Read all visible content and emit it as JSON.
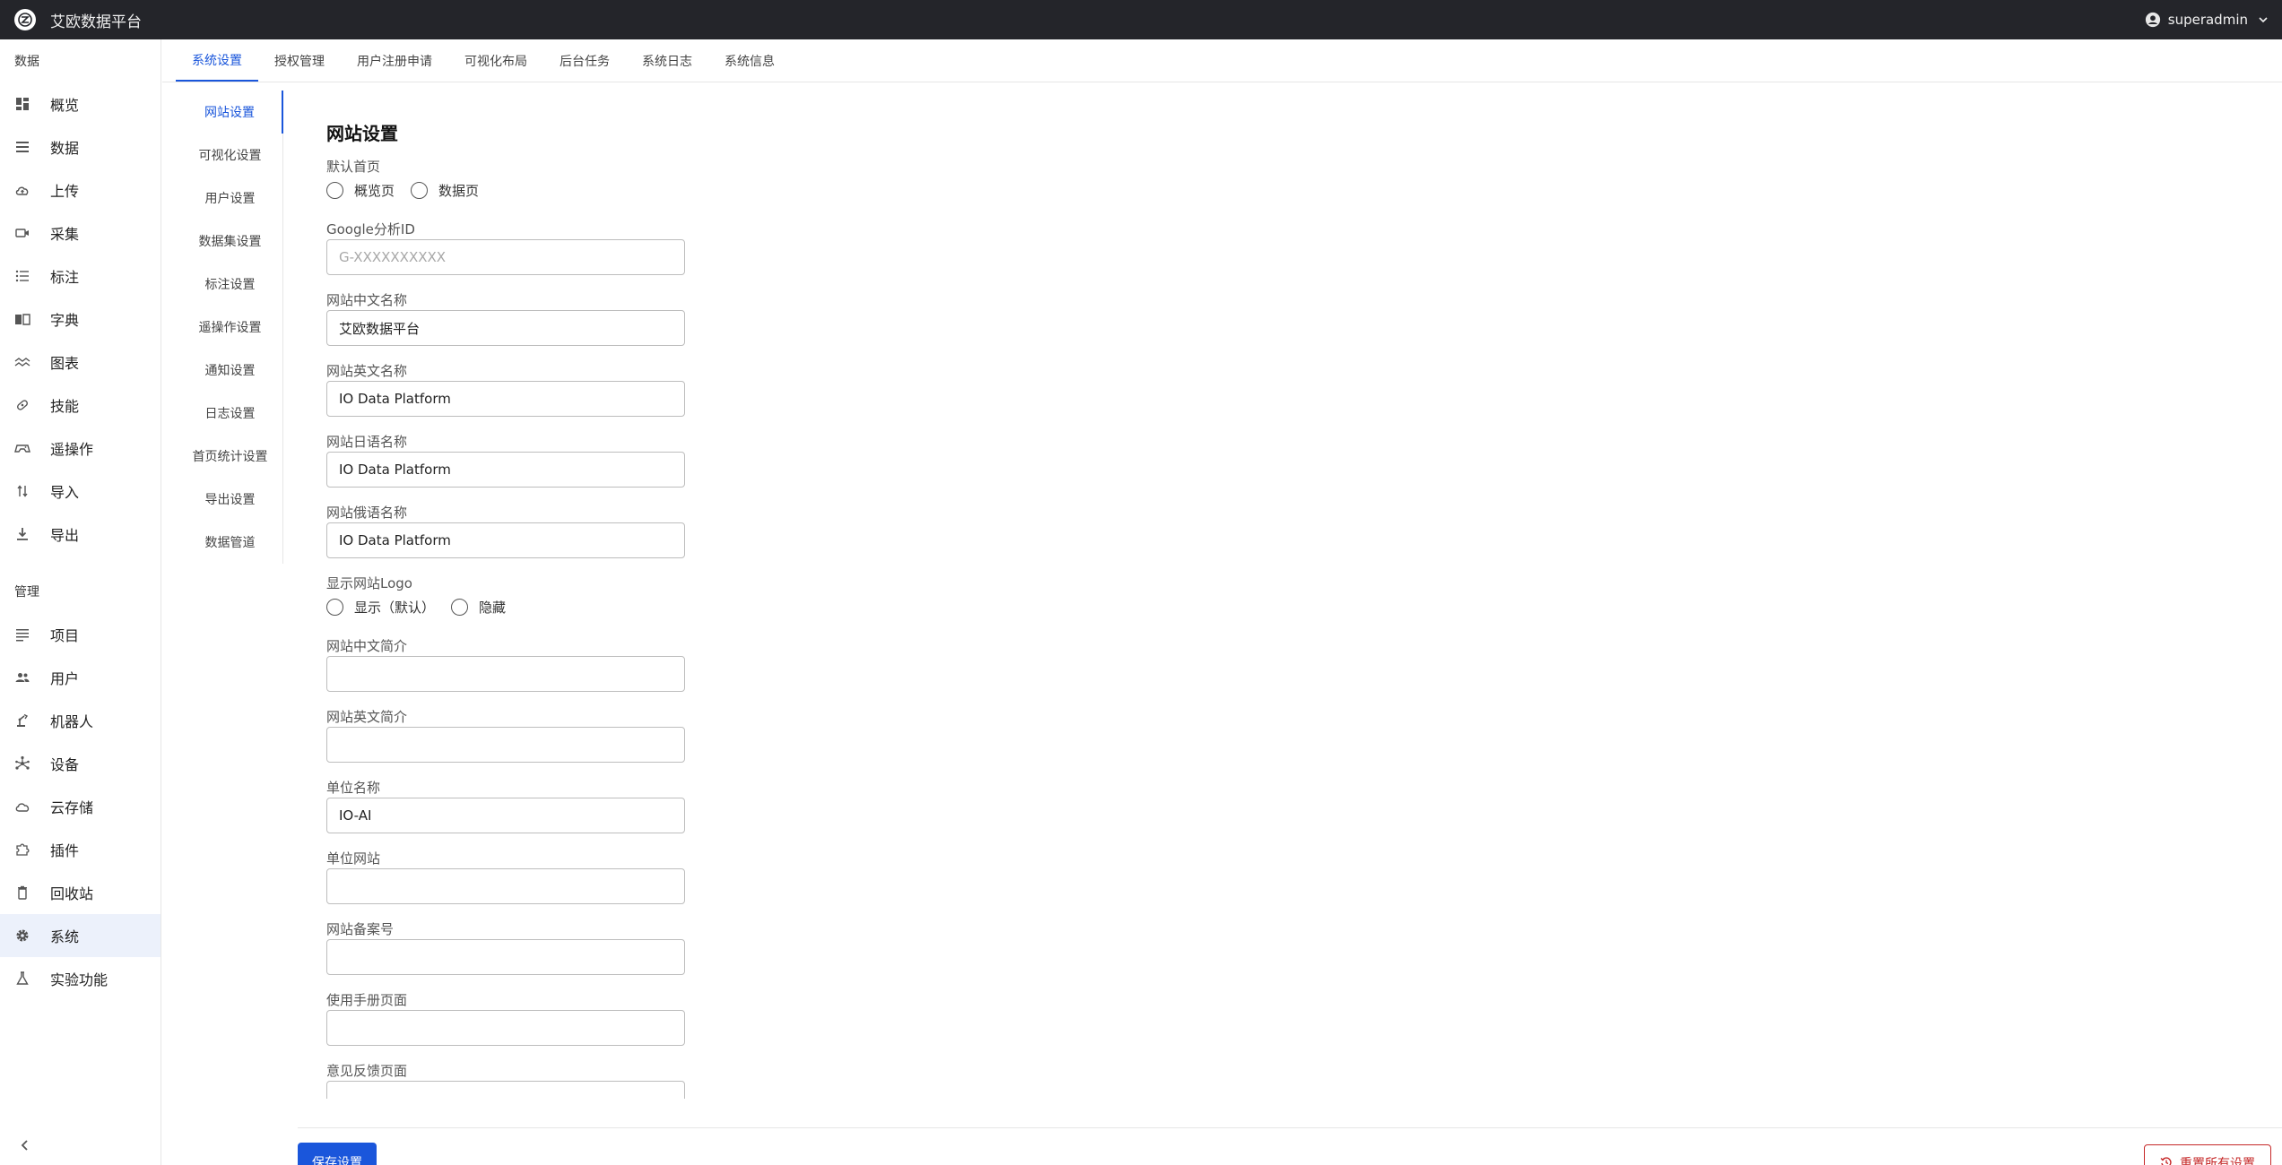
{
  "app": {
    "title": "艾欧数据平台",
    "user": "superadmin"
  },
  "sidebar": {
    "sections": [
      {
        "title": "数据",
        "items": [
          {
            "label": "概览",
            "icon": "dashboard-icon"
          },
          {
            "label": "数据",
            "icon": "list-icon"
          },
          {
            "label": "上传",
            "icon": "cloud-upload-icon"
          },
          {
            "label": "采集",
            "icon": "video-camera-icon"
          },
          {
            "label": "标注",
            "icon": "bullet-list-icon"
          },
          {
            "label": "字典",
            "icon": "book-icon"
          },
          {
            "label": "图表",
            "icon": "chart-wave-icon"
          },
          {
            "label": "技能",
            "icon": "skill-icon"
          },
          {
            "label": "遥操作",
            "icon": "gamepad-icon"
          },
          {
            "label": "导入",
            "icon": "import-icon"
          },
          {
            "label": "导出",
            "icon": "download-icon"
          }
        ]
      },
      {
        "title": "管理",
        "items": [
          {
            "label": "项目",
            "icon": "project-icon"
          },
          {
            "label": "用户",
            "icon": "users-icon"
          },
          {
            "label": "机器人",
            "icon": "robot-arm-icon"
          },
          {
            "label": "设备",
            "icon": "device-hub-icon"
          },
          {
            "label": "云存储",
            "icon": "cloud-icon"
          },
          {
            "label": "插件",
            "icon": "puzzle-icon"
          },
          {
            "label": "回收站",
            "icon": "trash-icon"
          },
          {
            "label": "系统",
            "icon": "gear-icon",
            "active": true
          },
          {
            "label": "实验功能",
            "icon": "flask-icon"
          }
        ]
      }
    ]
  },
  "tabs": [
    "系统设置",
    "授权管理",
    "用户注册申请",
    "可视化布局",
    "后台任务",
    "系统日志",
    "系统信息"
  ],
  "subnav": [
    "网站设置",
    "可视化设置",
    "用户设置",
    "数据集设置",
    "标注设置",
    "遥操作设置",
    "通知设置",
    "日志设置",
    "首页统计设置",
    "导出设置",
    "数据管道"
  ],
  "form": {
    "title": "网站设置",
    "default_home": {
      "label": "默认首页",
      "options": [
        "概览页",
        "数据页"
      ]
    },
    "ga_id": {
      "label": "Google分析ID",
      "value": "",
      "placeholder": "G-XXXXXXXXXX"
    },
    "name_zh": {
      "label": "网站中文名称",
      "value": "艾欧数据平台"
    },
    "name_en": {
      "label": "网站英文名称",
      "value": "IO Data Platform"
    },
    "name_ja": {
      "label": "网站日语名称",
      "value": "IO Data Platform"
    },
    "name_ru": {
      "label": "网站俄语名称",
      "value": "IO Data Platform"
    },
    "show_logo": {
      "label": "显示网站Logo",
      "options": [
        "显示（默认）",
        "隐藏"
      ]
    },
    "intro_zh": {
      "label": "网站中文简介",
      "value": ""
    },
    "intro_en": {
      "label": "网站英文简介",
      "value": ""
    },
    "org_name": {
      "label": "单位名称",
      "value": "IO-AI"
    },
    "org_site": {
      "label": "单位网站",
      "value": ""
    },
    "icp": {
      "label": "网站备案号",
      "value": ""
    },
    "manual": {
      "label": "使用手册页面",
      "value": ""
    },
    "feedback": {
      "label": "意见反馈页面",
      "value": ""
    }
  },
  "footer": {
    "save": "保存设置",
    "reset": "重置所有设置"
  },
  "colors": {
    "topbar": "#24252a",
    "accent": "#1a56db",
    "danger": "#c62828",
    "active_bg": "#ecf1fb"
  }
}
